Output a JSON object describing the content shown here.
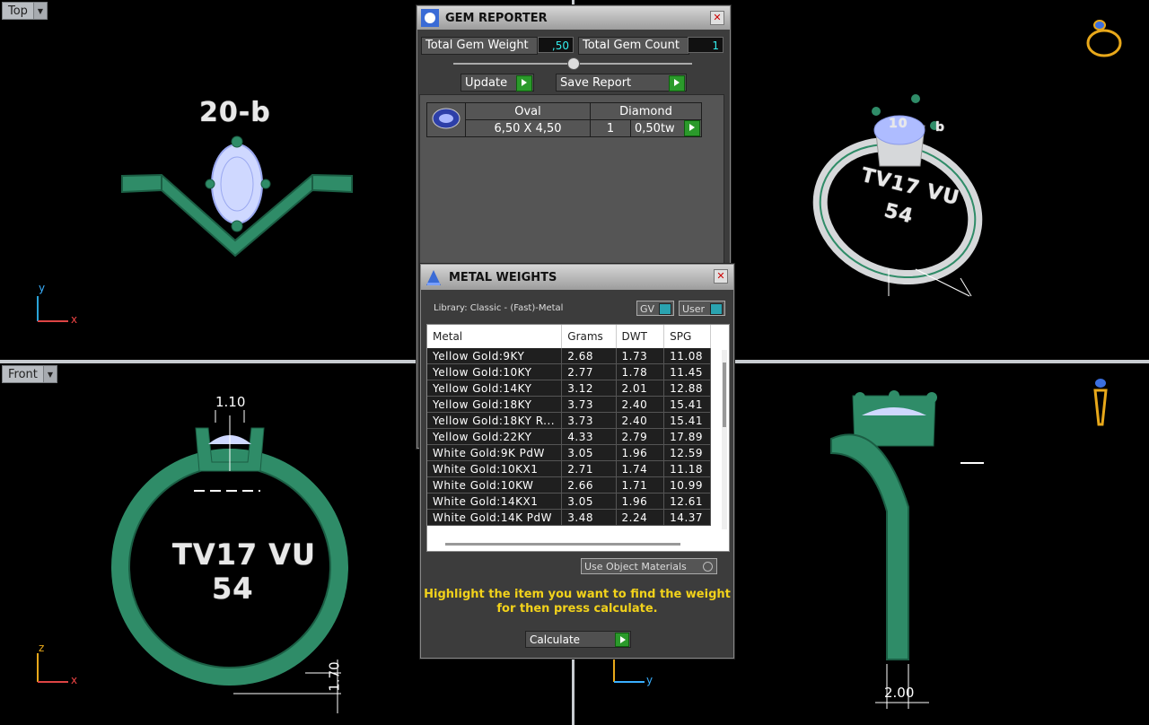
{
  "viewports": {
    "top": {
      "label": "Top",
      "ring_text": "20-b"
    },
    "front": {
      "label": "Front",
      "ring_line1": "TV17 VU",
      "ring_line2": "54",
      "dim_top": "1.10",
      "dim_bottom": "1.70"
    },
    "perspective": {
      "ring_line1": "TV17 VU",
      "ring_line2": "54",
      "gem_text_a": "10",
      "gem_text_b": "b"
    },
    "right": {
      "dim": "2.00"
    }
  },
  "gem_reporter": {
    "title": "GEM REPORTER",
    "total_weight_label": "Total Gem Weight",
    "total_weight_value": ",50",
    "total_count_label": "Total Gem Count",
    "total_count_value": "1",
    "update_label": "Update",
    "save_label": "Save Report",
    "gems": [
      {
        "shape": "Oval",
        "type": "Diamond",
        "size": "6,50 X 4,50",
        "qty": "1",
        "weight": "0,50tw"
      }
    ]
  },
  "metal_weights": {
    "title": "METAL WEIGHTS",
    "library": "Library: Classic - (Fast)-Metal",
    "gv_label": "GV",
    "user_label": "User",
    "columns": [
      "Metal",
      "Grams",
      "DWT",
      "SPG"
    ],
    "rows": [
      [
        "Yellow Gold:9KY",
        "2.68",
        "1.73",
        "11.08"
      ],
      [
        "Yellow Gold:10KY",
        "2.77",
        "1.78",
        "11.45"
      ],
      [
        "Yellow Gold:14KY",
        "3.12",
        "2.01",
        "12.88"
      ],
      [
        "Yellow Gold:18KY",
        "3.73",
        "2.40",
        "15.41"
      ],
      [
        "Yellow Gold:18KY R...",
        "3.73",
        "2.40",
        "15.41"
      ],
      [
        "Yellow Gold:22KY",
        "4.33",
        "2.79",
        "17.89"
      ],
      [
        "White Gold:9K PdW",
        "3.05",
        "1.96",
        "12.59"
      ],
      [
        "White Gold:10KX1",
        "2.71",
        "1.74",
        "11.18"
      ],
      [
        "White Gold:10KW",
        "2.66",
        "1.71",
        "10.99"
      ],
      [
        "White Gold:14KX1",
        "3.05",
        "1.96",
        "12.61"
      ],
      [
        "White Gold:14K PdW",
        "3.48",
        "2.24",
        "14.37"
      ]
    ],
    "use_object_materials": "Use Object Materials",
    "hint_line1": "Highlight the item you want to find the weight",
    "hint_line2": "for then press calculate.",
    "calculate_label": "Calculate"
  },
  "colors": {
    "ring_green": "#2e8a66",
    "hint_yellow": "#f2d21b",
    "value_cyan": "#33eeee"
  }
}
